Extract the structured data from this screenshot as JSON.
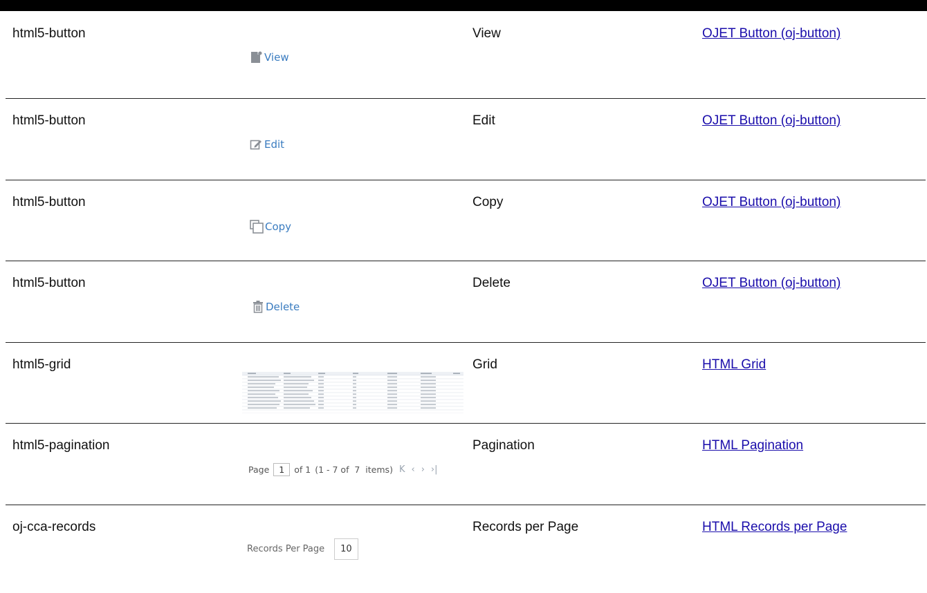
{
  "rows": [
    {
      "type": "html5-button",
      "label": "View",
      "link": "OJET Button (oj-button)",
      "sample_text": "View",
      "icon": "document-icon"
    },
    {
      "type": "html5-button",
      "label": "Edit",
      "link": "OJET Button (oj-button)",
      "sample_text": "Edit",
      "icon": "edit-icon"
    },
    {
      "type": "html5-button",
      "label": "Copy",
      "link": "OJET Button (oj-button)",
      "sample_text": "Copy",
      "icon": "copy-icon"
    },
    {
      "type": "html5-button",
      "label": "Delete",
      "link": "OJET Button (oj-button)",
      "sample_text": "Delete",
      "icon": "trash-icon"
    },
    {
      "type": "html5-grid",
      "label": "Grid",
      "link": "HTML Grid"
    },
    {
      "type": "html5-pagination",
      "label": "Pagination",
      "link": "HTML Pagination"
    },
    {
      "type": "oj-cca-records",
      "label": "Records per Page",
      "link": "HTML Records per Page"
    }
  ],
  "pagination_sample": {
    "page_label": "Page",
    "page_value": "1",
    "of_label": "of 1",
    "range_text": "(1 - 7 of  7  items)",
    "nav_icons": [
      "first-page-icon",
      "prev-page-icon",
      "next-page-icon",
      "last-page-icon"
    ]
  },
  "records_sample": {
    "label": "Records Per Page",
    "value": "10"
  },
  "colors": {
    "link": "#1a0dab",
    "button_text": "#3a7cc0",
    "icon_gray": "#8a8f96"
  }
}
